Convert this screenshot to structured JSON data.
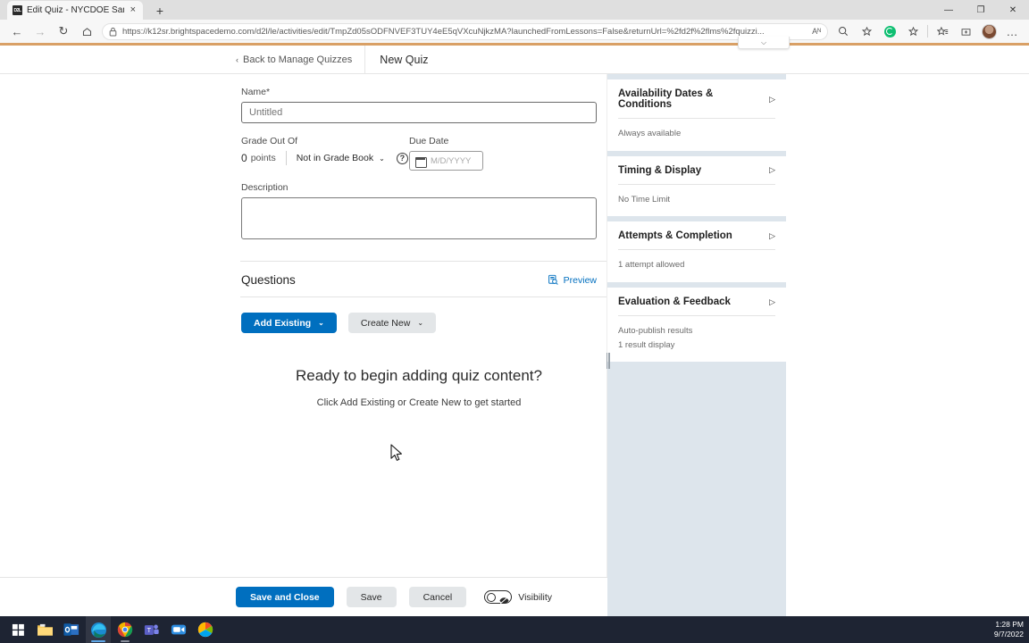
{
  "browser": {
    "tab": {
      "title": "Edit Quiz - NYCDOE Sandbox (P...",
      "favicon_label": "D2L",
      "close_label": "×"
    },
    "new_tab_label": "+",
    "window_controls": {
      "minimize": "—",
      "maximize": "❐",
      "close": "✕"
    },
    "nav": {
      "back": "←",
      "forward": "→",
      "reload": "↻",
      "home": "⌂"
    },
    "url": "https://k12sr.brightspacedemo.com/d2l/le/activities/edit/TmpZd05sODFNVEF3TUY4eE5qVXcuNjkzMA?launchedFromLessons=False&returnUrl=%2fd2f%2flms%2fquizzi...",
    "read_aloud_label": "Aᴺ",
    "zoom_label": "⌕",
    "favorite_label": "☆",
    "collections_label": "☰",
    "browser_essentials_label": "⊕",
    "settings_label": "…",
    "popup_chevron": "⌵"
  },
  "header": {
    "back_link": "Back to Manage Quizzes",
    "back_chevron": "‹",
    "title": "New Quiz"
  },
  "form": {
    "name_label": "Name",
    "name_required": "*",
    "name_value": "",
    "name_placeholder": "Untitled",
    "grade_label": "Grade Out Of",
    "points_value": "0",
    "points_word": "points",
    "gradebook_value": "Not in Grade Book",
    "gradebook_caret": "⌄",
    "help_label": "?",
    "due_date_label": "Due Date",
    "due_date_value": "",
    "due_date_placeholder": "M/D/YYYY",
    "description_label": "Description",
    "description_value": ""
  },
  "questions": {
    "title": "Questions",
    "preview_label": "Preview",
    "add_existing_label": "Add Existing",
    "add_existing_caret": "⌄",
    "create_new_label": "Create New",
    "create_new_caret": "⌄",
    "empty_title": "Ready to begin adding quiz content?",
    "empty_subtitle": "Click Add Existing or Create New to get started"
  },
  "sidebar": {
    "cards": [
      {
        "title": "Availability Dates & Conditions",
        "arrow": "▷",
        "lines": [
          "Always available"
        ]
      },
      {
        "title": "Timing & Display",
        "arrow": "▷",
        "lines": [
          "No Time Limit"
        ]
      },
      {
        "title": "Attempts & Completion",
        "arrow": "▷",
        "lines": [
          "1 attempt allowed"
        ]
      },
      {
        "title": "Evaluation & Feedback",
        "arrow": "▷",
        "lines": [
          "Auto-publish results",
          "1 result display"
        ]
      }
    ]
  },
  "footer": {
    "save_and_close_label": "Save and Close",
    "save_label": "Save",
    "cancel_label": "Cancel",
    "visibility_label": "Visibility"
  },
  "taskbar": {
    "apps": [
      "start-icon",
      "file-explorer-icon",
      "outlook-icon",
      "edge-icon",
      "chrome-icon",
      "teams-icon",
      "video-app-icon",
      "photos-icon"
    ],
    "time": "1:28 PM",
    "date": "9/7/2022"
  },
  "colors": {
    "accent_blue": "#006fbf",
    "sidebar_bg": "#dde5ec",
    "browser_accent": "#d9a066",
    "taskbar_bg": "#1e2433"
  }
}
